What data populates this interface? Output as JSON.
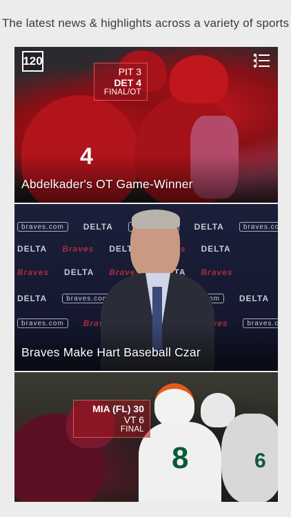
{
  "tagline": "The latest news & highlights across a variety of sports",
  "app": {
    "logo_text": "120"
  },
  "cards": [
    {
      "headline": "Abdelkader's OT Game-Winner",
      "score": {
        "line1": "PIT 3",
        "line2": "DET 4",
        "status": "FINAL/OT"
      }
    },
    {
      "headline": "Braves Make Hart Baseball Czar",
      "backdrop_words": [
        "braves.com",
        "DELTA",
        "Braves"
      ]
    },
    {
      "headline": "",
      "score": {
        "line1": "MIA (FL) 30",
        "line2": "VT 6",
        "status": "FINAL"
      }
    }
  ],
  "colors": {
    "tagline": "#3a3a3a",
    "score_bg": "#96141e",
    "page_bg": "#ececec"
  },
  "icons": [
    "app-logo-icon",
    "menu-icon"
  ]
}
